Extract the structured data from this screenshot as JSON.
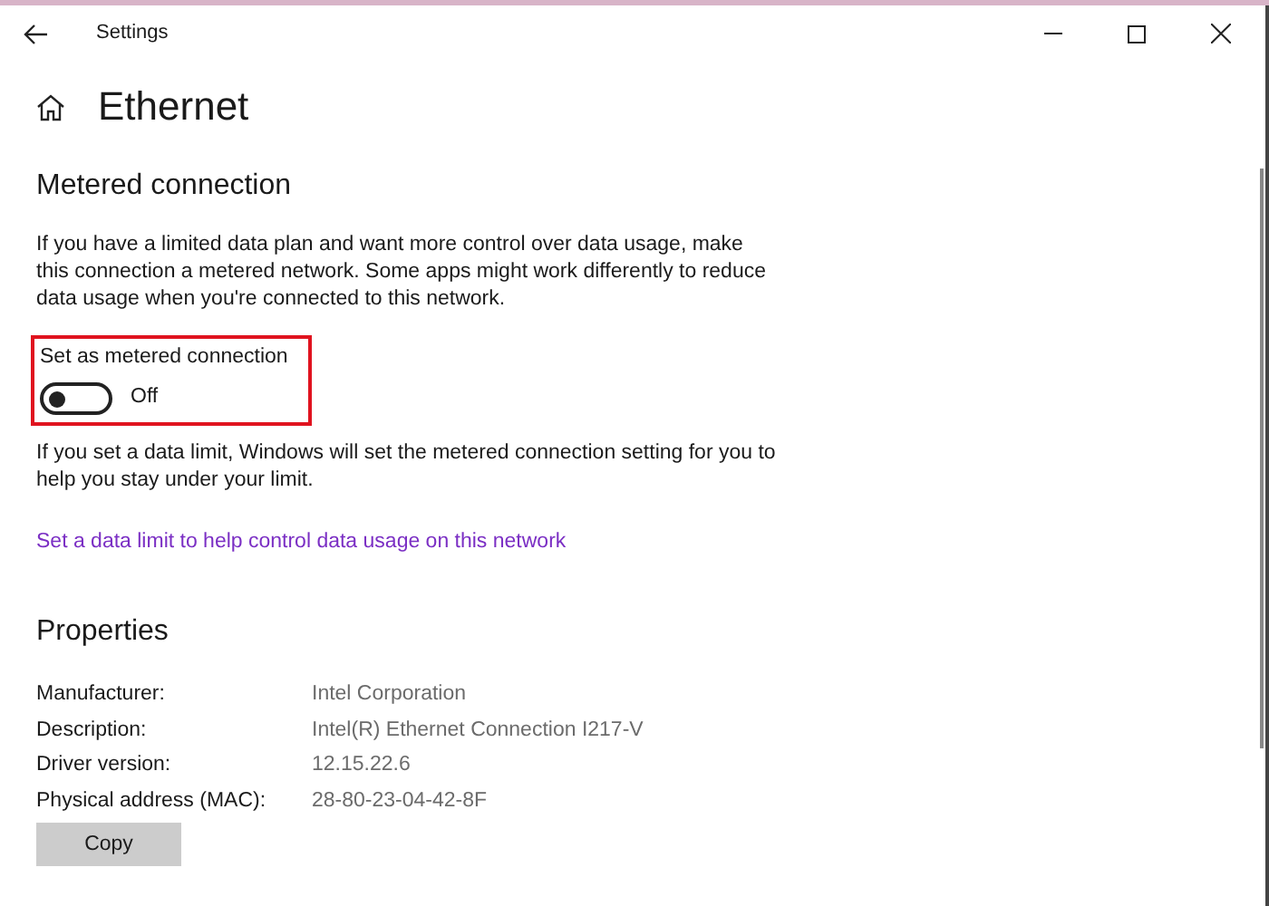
{
  "window": {
    "title": "Settings"
  },
  "page_title": "Ethernet",
  "metered": {
    "heading": "Metered connection",
    "description": "If you have a limited data plan and want more control over data usage, make this connection a metered network. Some apps might work differently to reduce data usage when you're connected to this network.",
    "toggle": {
      "label": "Set as metered connection",
      "on": false,
      "state_text": "Off",
      "highlighted": true
    },
    "note": "If you set a data limit, Windows will set the metered connection setting for you to help you stay under your limit.",
    "link": "Set a data limit to help control data usage on this network"
  },
  "properties": {
    "heading": "Properties",
    "rows": [
      {
        "label": "Manufacturer:",
        "value": "Intel Corporation"
      },
      {
        "label": "Description:",
        "value": "Intel(R) Ethernet Connection I217-V"
      },
      {
        "label": "Driver version:",
        "value": "12.15.22.6"
      },
      {
        "label": "Physical address (MAC):",
        "value": "28-80-23-04-42-8F"
      }
    ],
    "button": "Copy"
  }
}
